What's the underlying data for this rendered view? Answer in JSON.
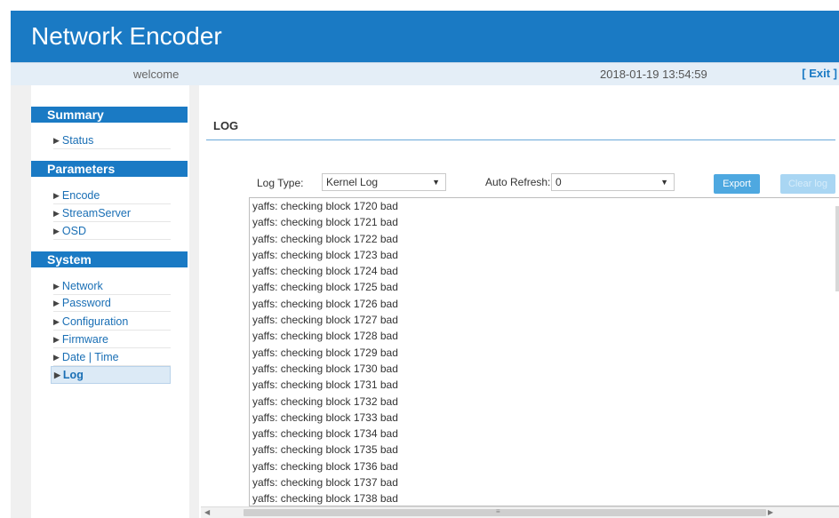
{
  "header": {
    "title": "Network Encoder"
  },
  "infobar": {
    "welcome": "welcome",
    "datetime": "2018-01-19 13:54:59",
    "exit": "[ Exit ]"
  },
  "sidebar": {
    "sections": [
      {
        "title": "Summary",
        "items": [
          "Status"
        ]
      },
      {
        "title": "Parameters",
        "items": [
          "Encode",
          "StreamServer",
          "OSD"
        ]
      },
      {
        "title": "System",
        "items": [
          "Network",
          "Password",
          "Configuration",
          "Firmware",
          "Date | Time",
          "Log"
        ]
      }
    ],
    "active_item": "Log"
  },
  "main": {
    "title": "LOG",
    "log_type_label": "Log Type:",
    "log_type_value": "Kernel Log",
    "auto_refresh_label": "Auto Refresh:",
    "auto_refresh_value": "0",
    "export_label": "Export",
    "clear_label": "Clear log",
    "log_lines": [
      "yaffs: checking block 1720 bad",
      "yaffs: checking block 1721 bad",
      "yaffs: checking block 1722 bad",
      "yaffs: checking block 1723 bad",
      "yaffs: checking block 1724 bad",
      "yaffs: checking block 1725 bad",
      "yaffs: checking block 1726 bad",
      "yaffs: checking block 1727 bad",
      "yaffs: checking block 1728 bad",
      "yaffs: checking block 1729 bad",
      "yaffs: checking block 1730 bad",
      "yaffs: checking block 1731 bad",
      "yaffs: checking block 1732 bad",
      "yaffs: checking block 1733 bad",
      "yaffs: checking block 1734 bad",
      "yaffs: checking block 1735 bad",
      "yaffs: checking block 1736 bad",
      "yaffs: checking block 1737 bad",
      "yaffs: checking block 1738 bad"
    ]
  },
  "colors": {
    "brand": "#1a7ac4",
    "button": "#4ea8e0",
    "button_disabled": "#a9d6f3"
  },
  "icons": {
    "nav_arrow": "triangle-right-icon",
    "select_caret": "caret-down-icon"
  }
}
